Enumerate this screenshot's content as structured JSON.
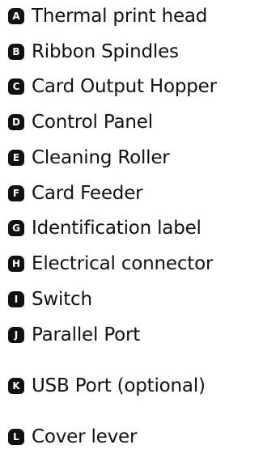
{
  "items": [
    {
      "letter": "A",
      "label": "Thermal print head"
    },
    {
      "letter": "B",
      "label": "Ribbon Spindles"
    },
    {
      "letter": "C",
      "label": "Card Output Hopper"
    },
    {
      "letter": "D",
      "label": "Control Panel"
    },
    {
      "letter": "E",
      "label": "Cleaning Roller"
    },
    {
      "letter": "F",
      "label": "Card Feeder"
    },
    {
      "letter": "G",
      "label": "Identification label"
    },
    {
      "letter": "H",
      "label": "Electrical connector"
    },
    {
      "letter": "I",
      "label": "Switch"
    },
    {
      "letter": "J",
      "label": "Parallel Port"
    },
    {
      "letter": "K",
      "label": "USB Port (optional)"
    },
    {
      "letter": "L",
      "label": "Cover lever"
    }
  ]
}
